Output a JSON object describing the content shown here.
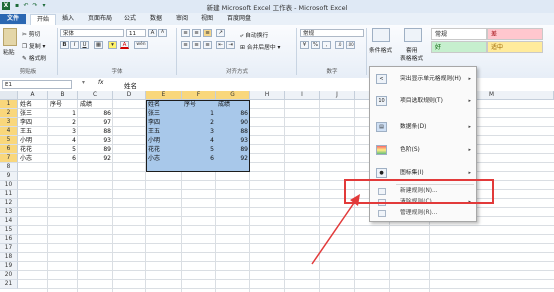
{
  "window": {
    "title": "新建 Microsoft Excel 工作表 - Microsoft Excel"
  },
  "tabs": [
    "文件",
    "开始",
    "插入",
    "页面布局",
    "公式",
    "数据",
    "审阅",
    "视图",
    "百度网盘"
  ],
  "clipboard": {
    "paste": "粘贴",
    "cut": "剪切",
    "copy": "复制",
    "format_painter": "格式刷",
    "group": "剪贴板"
  },
  "font": {
    "name": "宋体",
    "size": "11",
    "bold": "B",
    "italic": "I",
    "underline": "U",
    "grow": "A",
    "shrink": "A",
    "font_color": "A",
    "pinyin": "wén",
    "group": "字体"
  },
  "alignment": {
    "wrap": "自动换行",
    "merge": "合并后居中",
    "group": "对齐方式"
  },
  "number": {
    "format": "常规",
    "currency": "¥",
    "percent": "%",
    "comma": ",",
    "group": "数字"
  },
  "styles": {
    "cond_format": "条件格式",
    "table_format": "套用",
    "table_format2": "表格格式",
    "cells": [
      "常规",
      "差",
      "好",
      "适中"
    ],
    "group": "样式"
  },
  "formula_bar": {
    "namebox": "E1",
    "fx": "fx",
    "content": "姓名"
  },
  "columns": [
    "A",
    "B",
    "C",
    "D",
    "E",
    "F",
    "G",
    "H",
    "I",
    "J",
    "K",
    "L",
    "M"
  ],
  "rows": [
    "1",
    "2",
    "3",
    "4",
    "5",
    "6",
    "7",
    "8",
    "9",
    "10",
    "11",
    "12",
    "13",
    "14",
    "15",
    "16",
    "17",
    "18",
    "19",
    "20",
    "21"
  ],
  "table_left": {
    "headers": [
      "姓名",
      "序号",
      "成绩"
    ],
    "rows": [
      [
        "张三",
        "1",
        "86"
      ],
      [
        "李四",
        "2",
        "97"
      ],
      [
        "王五",
        "3",
        "88"
      ],
      [
        "小明",
        "4",
        "93"
      ],
      [
        "花花",
        "5",
        "89"
      ],
      [
        "小志",
        "6",
        "92"
      ]
    ]
  },
  "table_right": {
    "headers": [
      "姓名",
      "序号",
      "成绩"
    ],
    "rows": [
      [
        "张三",
        "1",
        "86"
      ],
      [
        "李四",
        "2",
        "90"
      ],
      [
        "王五",
        "3",
        "88"
      ],
      [
        "小明",
        "4",
        "93"
      ],
      [
        "花花",
        "5",
        "89"
      ],
      [
        "小志",
        "6",
        "92"
      ]
    ]
  },
  "context_menu": {
    "items": [
      {
        "label": "突出显示单元格规则(H)",
        "arrow": "▸"
      },
      {
        "label": "项目选取规则(T)",
        "arrow": "▸"
      },
      {
        "label": "数据条(D)",
        "arrow": "▸"
      },
      {
        "label": "色阶(S)",
        "arrow": "▸"
      },
      {
        "label": "图标集(I)",
        "arrow": "▸"
      }
    ],
    "new_rule": "新建规则(N)...",
    "clear_rules": "清除规则(C)",
    "manage_rules": "管理规则(R)..."
  },
  "colors": {
    "accent": "#2b67b2",
    "selection": "#a8c8ea",
    "header_sel": "#f9d77c",
    "highlight": "#e23a3a"
  }
}
